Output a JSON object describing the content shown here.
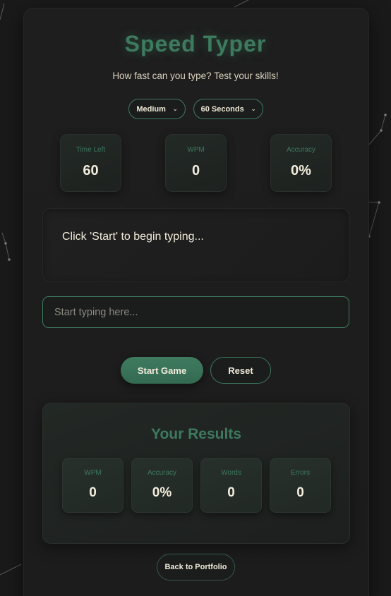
{
  "header": {
    "title": "Speed Typer",
    "subtitle": "How fast can you type? Test your skills!"
  },
  "settings": {
    "difficulty": "Medium",
    "duration": "60 Seconds"
  },
  "stats": {
    "time_left": {
      "label": "Time Left",
      "value": "60"
    },
    "wpm": {
      "label": "WPM",
      "value": "0"
    },
    "accuracy": {
      "label": "Accuracy",
      "value": "0%"
    }
  },
  "text_display": "Click 'Start' to begin typing...",
  "input": {
    "placeholder": "Start typing here...",
    "value": ""
  },
  "buttons": {
    "start": "Start Game",
    "reset": "Reset",
    "back": "Back to Portfolio"
  },
  "results": {
    "title": "Your Results",
    "items": [
      {
        "label": "WPM",
        "value": "0"
      },
      {
        "label": "Accuracy",
        "value": "0%"
      },
      {
        "label": "Words",
        "value": "0"
      },
      {
        "label": "Errors",
        "value": "0"
      }
    ]
  },
  "colors": {
    "accent": "#3d7a5e",
    "background": "#1a1a1a",
    "card": "#1e1e1e",
    "text": "#f0ead8"
  }
}
